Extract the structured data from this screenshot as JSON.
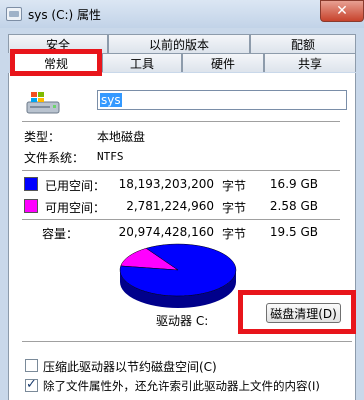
{
  "window": {
    "title": "sys (C:) 属性",
    "close_label": "✕"
  },
  "tabs": {
    "row1": [
      "安全",
      "以前的版本",
      "配额"
    ],
    "row2": [
      "常规",
      "工具",
      "硬件",
      "共享"
    ],
    "active": "常规"
  },
  "general": {
    "drive_name": "sys",
    "type_label": "类型：",
    "type_value": "本地磁盘",
    "fs_label": "文件系统：",
    "fs_value": "NTFS",
    "used": {
      "label": "已用空间：",
      "bytes": "18,193,203,200",
      "unit": "字节",
      "size": "16.9 GB",
      "color": "#0000ff"
    },
    "free": {
      "label": "可用空间：",
      "bytes": "2,781,224,960",
      "unit": "字节",
      "size": "2.58 GB",
      "color": "#ff00ff"
    },
    "capacity": {
      "label": "容量：",
      "bytes": "20,974,428,160",
      "unit": "字节",
      "size": "19.5 GB"
    },
    "drive_label": "驱动器 C:",
    "cleanup_button": "磁盘清理(D)",
    "compress_checkbox": {
      "label": "压缩此驱动器以节约磁盘空间(C)",
      "checked": false
    },
    "index_checkbox": {
      "label": "除了文件属性外，还允许索引此驱动器上文件的内容(I)",
      "checked": true
    }
  },
  "chart_data": {
    "type": "pie",
    "categories": [
      "已用空间",
      "可用空间"
    ],
    "values": [
      18193203200,
      2781224960
    ],
    "colors": [
      "#0000ff",
      "#ff00ff"
    ]
  }
}
